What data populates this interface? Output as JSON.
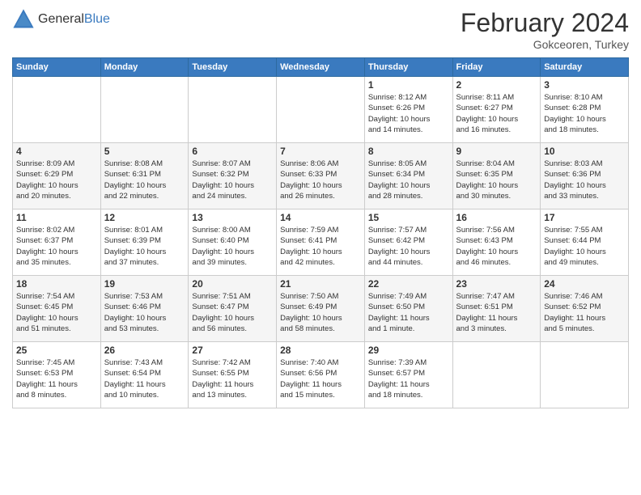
{
  "logo": {
    "general": "General",
    "blue": "Blue"
  },
  "header": {
    "title": "February 2024",
    "location": "Gokceoren, Turkey"
  },
  "weekdays": [
    "Sunday",
    "Monday",
    "Tuesday",
    "Wednesday",
    "Thursday",
    "Friday",
    "Saturday"
  ],
  "weeks": [
    [
      {
        "day": "",
        "info": ""
      },
      {
        "day": "",
        "info": ""
      },
      {
        "day": "",
        "info": ""
      },
      {
        "day": "",
        "info": ""
      },
      {
        "day": "1",
        "info": "Sunrise: 8:12 AM\nSunset: 6:26 PM\nDaylight: 10 hours\nand 14 minutes."
      },
      {
        "day": "2",
        "info": "Sunrise: 8:11 AM\nSunset: 6:27 PM\nDaylight: 10 hours\nand 16 minutes."
      },
      {
        "day": "3",
        "info": "Sunrise: 8:10 AM\nSunset: 6:28 PM\nDaylight: 10 hours\nand 18 minutes."
      }
    ],
    [
      {
        "day": "4",
        "info": "Sunrise: 8:09 AM\nSunset: 6:29 PM\nDaylight: 10 hours\nand 20 minutes."
      },
      {
        "day": "5",
        "info": "Sunrise: 8:08 AM\nSunset: 6:31 PM\nDaylight: 10 hours\nand 22 minutes."
      },
      {
        "day": "6",
        "info": "Sunrise: 8:07 AM\nSunset: 6:32 PM\nDaylight: 10 hours\nand 24 minutes."
      },
      {
        "day": "7",
        "info": "Sunrise: 8:06 AM\nSunset: 6:33 PM\nDaylight: 10 hours\nand 26 minutes."
      },
      {
        "day": "8",
        "info": "Sunrise: 8:05 AM\nSunset: 6:34 PM\nDaylight: 10 hours\nand 28 minutes."
      },
      {
        "day": "9",
        "info": "Sunrise: 8:04 AM\nSunset: 6:35 PM\nDaylight: 10 hours\nand 30 minutes."
      },
      {
        "day": "10",
        "info": "Sunrise: 8:03 AM\nSunset: 6:36 PM\nDaylight: 10 hours\nand 33 minutes."
      }
    ],
    [
      {
        "day": "11",
        "info": "Sunrise: 8:02 AM\nSunset: 6:37 PM\nDaylight: 10 hours\nand 35 minutes."
      },
      {
        "day": "12",
        "info": "Sunrise: 8:01 AM\nSunset: 6:39 PM\nDaylight: 10 hours\nand 37 minutes."
      },
      {
        "day": "13",
        "info": "Sunrise: 8:00 AM\nSunset: 6:40 PM\nDaylight: 10 hours\nand 39 minutes."
      },
      {
        "day": "14",
        "info": "Sunrise: 7:59 AM\nSunset: 6:41 PM\nDaylight: 10 hours\nand 42 minutes."
      },
      {
        "day": "15",
        "info": "Sunrise: 7:57 AM\nSunset: 6:42 PM\nDaylight: 10 hours\nand 44 minutes."
      },
      {
        "day": "16",
        "info": "Sunrise: 7:56 AM\nSunset: 6:43 PM\nDaylight: 10 hours\nand 46 minutes."
      },
      {
        "day": "17",
        "info": "Sunrise: 7:55 AM\nSunset: 6:44 PM\nDaylight: 10 hours\nand 49 minutes."
      }
    ],
    [
      {
        "day": "18",
        "info": "Sunrise: 7:54 AM\nSunset: 6:45 PM\nDaylight: 10 hours\nand 51 minutes."
      },
      {
        "day": "19",
        "info": "Sunrise: 7:53 AM\nSunset: 6:46 PM\nDaylight: 10 hours\nand 53 minutes."
      },
      {
        "day": "20",
        "info": "Sunrise: 7:51 AM\nSunset: 6:47 PM\nDaylight: 10 hours\nand 56 minutes."
      },
      {
        "day": "21",
        "info": "Sunrise: 7:50 AM\nSunset: 6:49 PM\nDaylight: 10 hours\nand 58 minutes."
      },
      {
        "day": "22",
        "info": "Sunrise: 7:49 AM\nSunset: 6:50 PM\nDaylight: 11 hours\nand 1 minute."
      },
      {
        "day": "23",
        "info": "Sunrise: 7:47 AM\nSunset: 6:51 PM\nDaylight: 11 hours\nand 3 minutes."
      },
      {
        "day": "24",
        "info": "Sunrise: 7:46 AM\nSunset: 6:52 PM\nDaylight: 11 hours\nand 5 minutes."
      }
    ],
    [
      {
        "day": "25",
        "info": "Sunrise: 7:45 AM\nSunset: 6:53 PM\nDaylight: 11 hours\nand 8 minutes."
      },
      {
        "day": "26",
        "info": "Sunrise: 7:43 AM\nSunset: 6:54 PM\nDaylight: 11 hours\nand 10 minutes."
      },
      {
        "day": "27",
        "info": "Sunrise: 7:42 AM\nSunset: 6:55 PM\nDaylight: 11 hours\nand 13 minutes."
      },
      {
        "day": "28",
        "info": "Sunrise: 7:40 AM\nSunset: 6:56 PM\nDaylight: 11 hours\nand 15 minutes."
      },
      {
        "day": "29",
        "info": "Sunrise: 7:39 AM\nSunset: 6:57 PM\nDaylight: 11 hours\nand 18 minutes."
      },
      {
        "day": "",
        "info": ""
      },
      {
        "day": "",
        "info": ""
      }
    ]
  ]
}
